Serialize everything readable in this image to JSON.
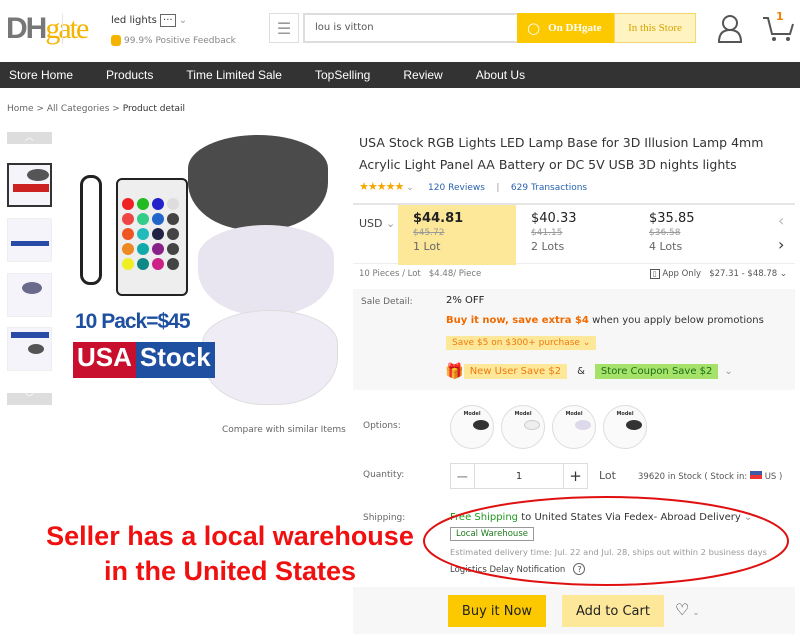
{
  "header": {
    "logo": "DHgate",
    "store_name": "led lights",
    "feedback": "99.9% Positive Feedback",
    "search_value": "lou is vitton",
    "on_dhgate": "On DHgate",
    "in_store": "In this Store",
    "cart_count": "1"
  },
  "nav": [
    "Store Home",
    "Products",
    "Time Limited Sale",
    "TopSelling",
    "Review",
    "About Us"
  ],
  "breadcrumb": {
    "home": "Home",
    "sep": ">",
    "all": "All Categories",
    "current": "Product detail"
  },
  "gallery": {
    "promo1": "10 Pack=$45",
    "promo_usa": "USA",
    "promo_stock": "Stock",
    "compare": "Compare with similar Items"
  },
  "product": {
    "title": "USA Stock RGB Lights LED Lamp Base for 3D Illusion Lamp 4mm Acrylic Light Panel AA Battery or DC 5V USB 3D nights lights",
    "rating_stars": 5,
    "reviews_count": "120",
    "reviews_label": "Reviews",
    "sep": "|",
    "transactions_count": "629",
    "transactions_label": "Transactions"
  },
  "pricing": {
    "currency": "USD",
    "tiers": [
      {
        "price": "$44.81",
        "original": "$45.72",
        "qty": "1 Lot"
      },
      {
        "price": "$40.33",
        "original": "$41.15",
        "qty": "2 Lots"
      },
      {
        "price": "$35.85",
        "original": "$36.58",
        "qty": "4 Lots"
      }
    ],
    "pieces": "10 Pieces / Lot",
    "per_piece": "$4.48/ Piece",
    "app_only": "App Only",
    "app_range": "$27.31 - $48.78"
  },
  "sale": {
    "label": "Sale Detail:",
    "off": "2% OFF",
    "buy_now_save": "Buy it now, save extra $4",
    "promo_text": "when you apply below promotions",
    "coupon1": "Save $5 on $300+ purchase",
    "new_user": "New User Save $2",
    "amp": "&",
    "store_coupon": "Store Coupon Save $2"
  },
  "options": {
    "label": "Options:",
    "items": [
      "Model",
      "Model",
      "Model",
      "Model"
    ]
  },
  "quantity": {
    "label": "Quantity:",
    "value": "1",
    "unit": "Lot",
    "stock": "39620 in Stock ( Stock in:",
    "stock_country": "US )"
  },
  "shipping": {
    "label": "Shipping:",
    "free": "Free Shipping",
    "to": "to",
    "dest": "United States Via Fedex- Abroad Delivery",
    "badge": "Local Warehouse",
    "estimate": "Estimated delivery time: Jul. 22 and Jul. 28, ships out within 2 business days",
    "logistics": "Logistics Delay Notification"
  },
  "actions": {
    "buy": "Buy it Now",
    "cart": "Add to Cart"
  },
  "annotation": {
    "line1": "Seller has a local warehouse",
    "line2": "in the United States"
  },
  "colors": {
    "accent": "#fcc800",
    "nav_bg": "#333333",
    "annotation": "#f01010",
    "free_shipping": "#1e9a1e",
    "promo_orange": "#f06a00"
  }
}
